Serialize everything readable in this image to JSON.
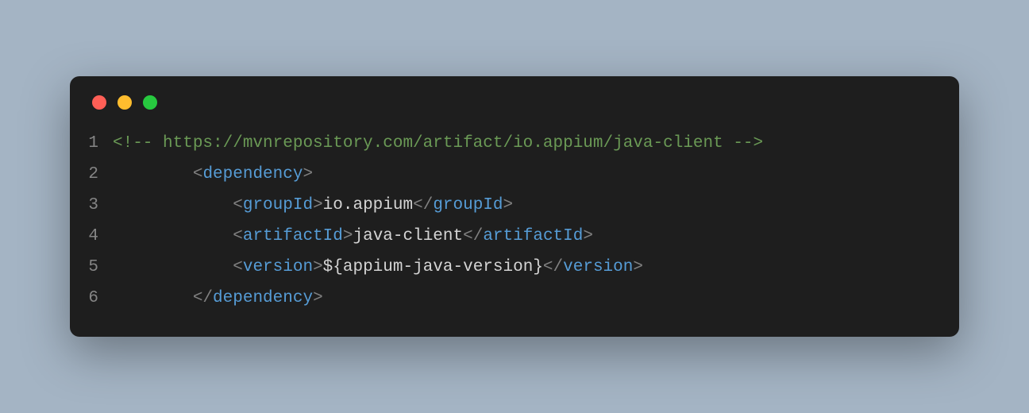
{
  "lines": [
    {
      "num": "1",
      "segments": [
        {
          "type": "comment",
          "text": "<!-- https://mvnrepository.com/artifact/io.appium/java-client -->"
        }
      ],
      "indent": ""
    },
    {
      "num": "2",
      "segments": [
        {
          "type": "bracket",
          "text": "<"
        },
        {
          "type": "tag",
          "text": "dependency"
        },
        {
          "type": "bracket",
          "text": ">"
        }
      ],
      "indent": "        "
    },
    {
      "num": "3",
      "segments": [
        {
          "type": "bracket",
          "text": "<"
        },
        {
          "type": "tag",
          "text": "groupId"
        },
        {
          "type": "bracket",
          "text": ">"
        },
        {
          "type": "text",
          "text": "io.appium"
        },
        {
          "type": "bracket",
          "text": "</"
        },
        {
          "type": "tag",
          "text": "groupId"
        },
        {
          "type": "bracket",
          "text": ">"
        }
      ],
      "indent": "            "
    },
    {
      "num": "4",
      "segments": [
        {
          "type": "bracket",
          "text": "<"
        },
        {
          "type": "tag",
          "text": "artifactId"
        },
        {
          "type": "bracket",
          "text": ">"
        },
        {
          "type": "text",
          "text": "java-client"
        },
        {
          "type": "bracket",
          "text": "</"
        },
        {
          "type": "tag",
          "text": "artifactId"
        },
        {
          "type": "bracket",
          "text": ">"
        }
      ],
      "indent": "            "
    },
    {
      "num": "5",
      "segments": [
        {
          "type": "bracket",
          "text": "<"
        },
        {
          "type": "tag",
          "text": "version"
        },
        {
          "type": "bracket",
          "text": ">"
        },
        {
          "type": "text",
          "text": "${appium-java-version}"
        },
        {
          "type": "bracket",
          "text": "</"
        },
        {
          "type": "tag",
          "text": "version"
        },
        {
          "type": "bracket",
          "text": ">"
        }
      ],
      "indent": "            "
    },
    {
      "num": "6",
      "segments": [
        {
          "type": "bracket",
          "text": "</"
        },
        {
          "type": "tag",
          "text": "dependency"
        },
        {
          "type": "bracket",
          "text": ">"
        }
      ],
      "indent": "        "
    }
  ]
}
